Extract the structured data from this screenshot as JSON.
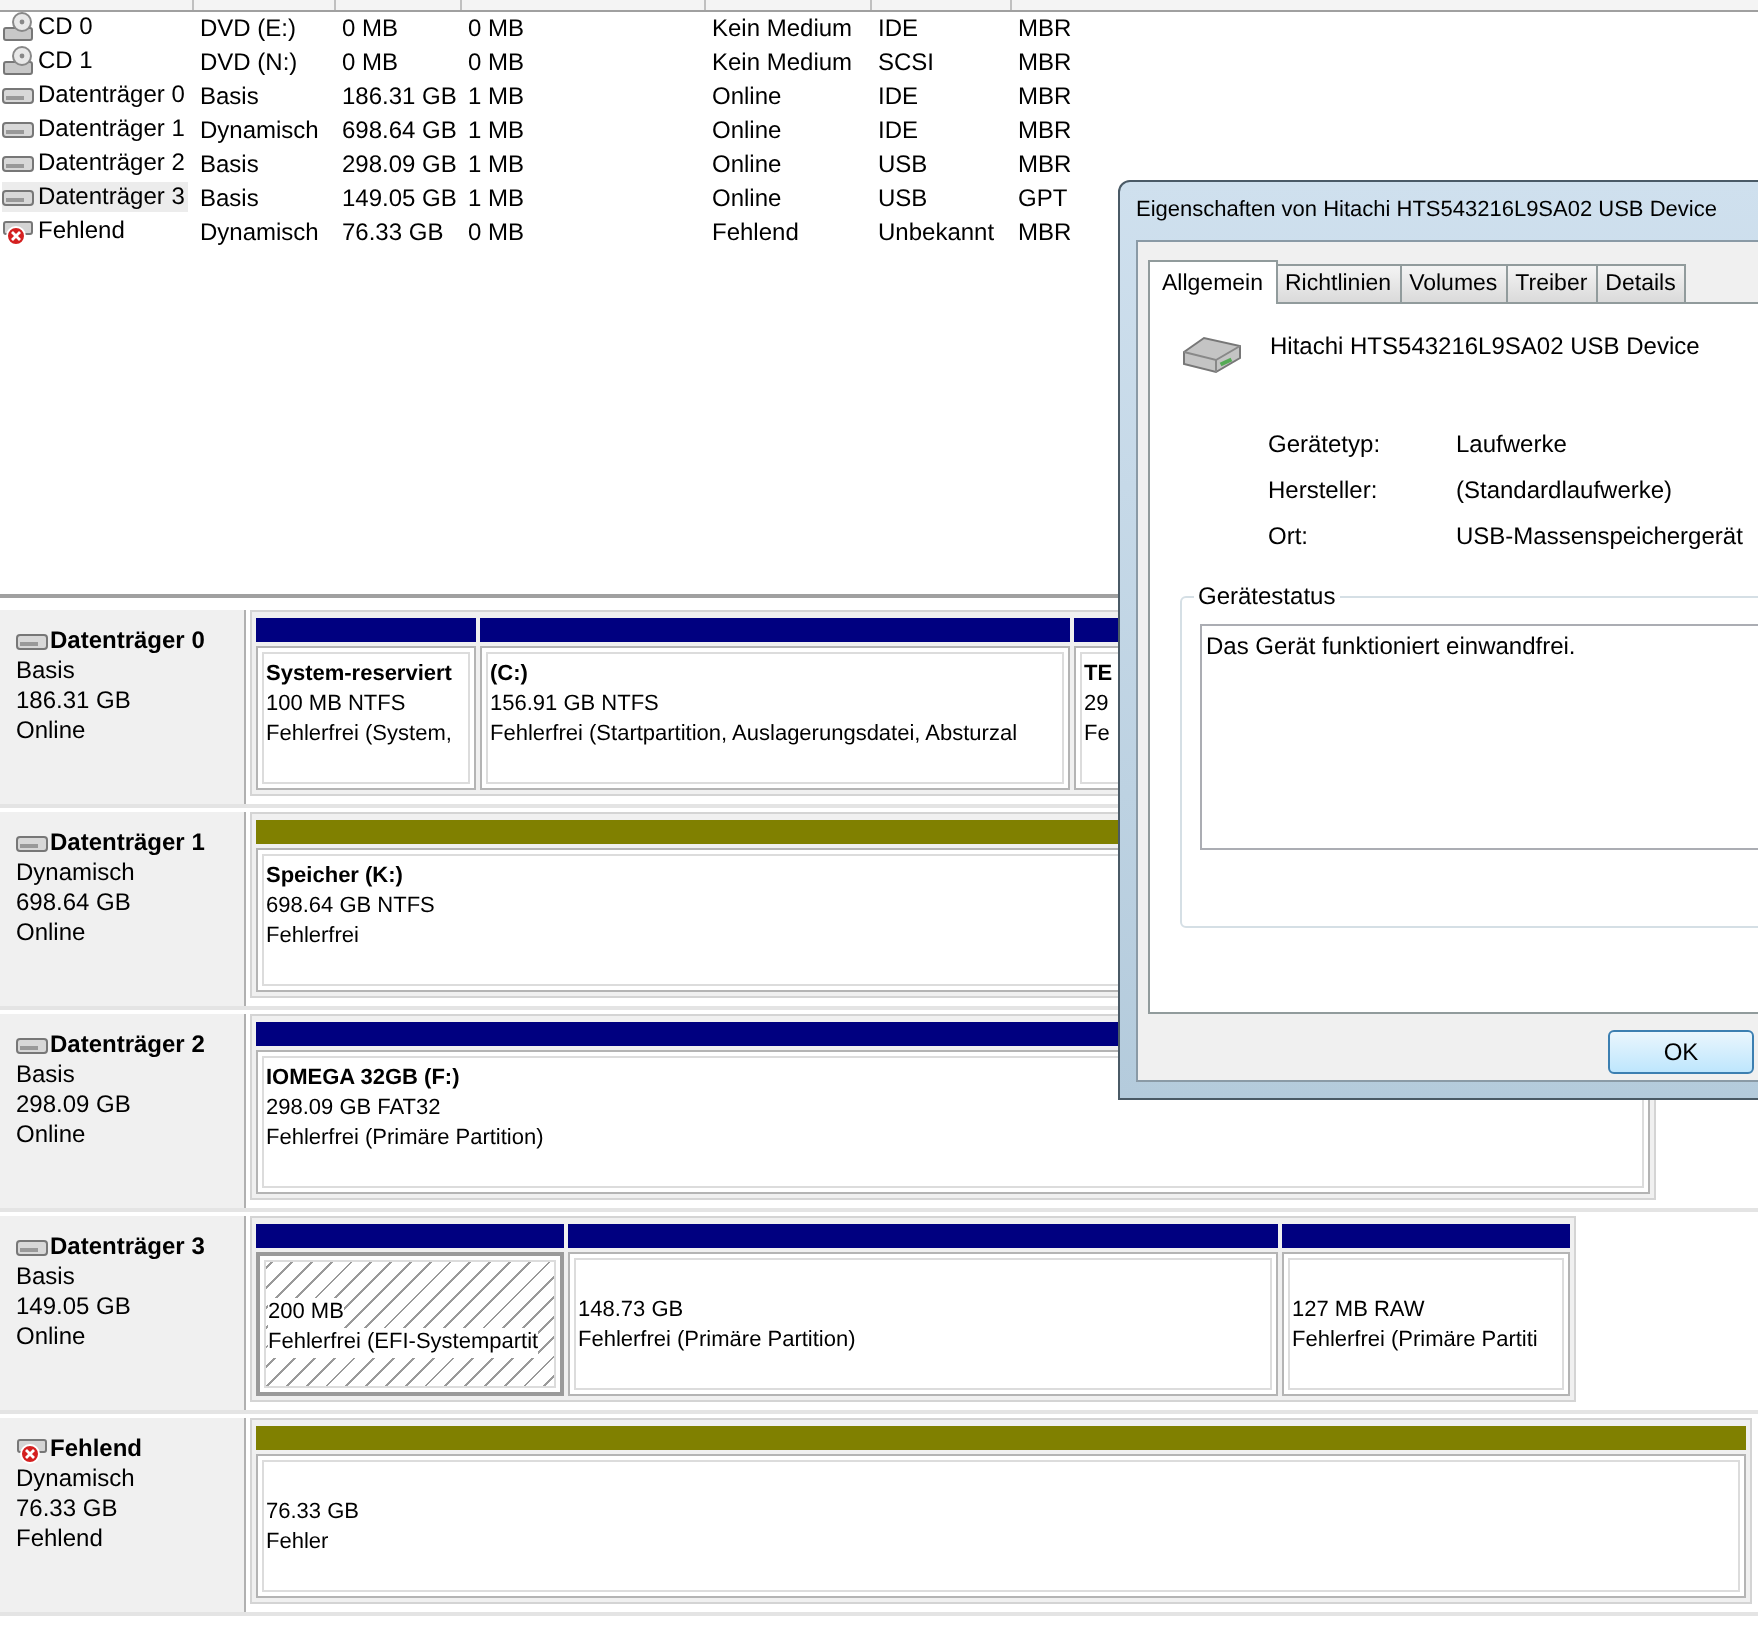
{
  "volume_list": {
    "rows": [
      {
        "kind": "cd",
        "selected": false,
        "cells": [
          "CD 0",
          "DVD (E:)",
          "0 MB",
          "0 MB",
          "Kein Medium",
          "IDE",
          "MBR"
        ]
      },
      {
        "kind": "cd",
        "selected": false,
        "cells": [
          "CD 1",
          "DVD (N:)",
          "0 MB",
          "0 MB",
          "Kein Medium",
          "SCSI",
          "MBR"
        ]
      },
      {
        "kind": "disk",
        "selected": false,
        "cells": [
          "Datenträger 0",
          "Basis",
          "186.31 GB",
          "1 MB",
          "Online",
          "IDE",
          "MBR"
        ]
      },
      {
        "kind": "disk",
        "selected": false,
        "cells": [
          "Datenträger 1",
          "Dynamisch",
          "698.64 GB",
          "1 MB",
          "Online",
          "IDE",
          "MBR"
        ]
      },
      {
        "kind": "disk",
        "selected": false,
        "cells": [
          "Datenträger 2",
          "Basis",
          "298.09 GB",
          "1 MB",
          "Online",
          "USB",
          "MBR"
        ]
      },
      {
        "kind": "disk",
        "selected": true,
        "cells": [
          "Datenträger 3",
          "Basis",
          "149.05 GB",
          "1 MB",
          "Online",
          "USB",
          "GPT"
        ]
      },
      {
        "kind": "missing",
        "selected": false,
        "cells": [
          "Fehlend",
          "Dynamisch",
          "76.33 GB",
          "0 MB",
          "Fehlend",
          "Unbekannt",
          "MBR"
        ]
      }
    ]
  },
  "disk_map": [
    {
      "kind": "disk",
      "name": "Datenträger 0",
      "type": "Basis",
      "size": "186.31 GB",
      "status": "Online",
      "partitions": [
        {
          "kind": "primary",
          "selected": false,
          "title": "System-reserviert",
          "detail": "100 MB NTFS",
          "status": "Fehlerfrei (System,"
        },
        {
          "kind": "primary",
          "selected": false,
          "title": "(C:)",
          "detail": "156.91 GB NTFS",
          "status": "Fehlerfrei (Startpartition, Auslagerungsdatei, Absturzal"
        },
        {
          "kind": "primary",
          "selected": false,
          "title": "TE",
          "detail": "29",
          "status": "Fe"
        }
      ]
    },
    {
      "kind": "disk",
      "name": "Datenträger 1",
      "type": "Dynamisch",
      "size": "698.64 GB",
      "status": "Online",
      "partitions": [
        {
          "kind": "simple",
          "selected": false,
          "title": "Speicher  (K:)",
          "detail": "698.64 GB NTFS",
          "status": "Fehlerfrei"
        }
      ]
    },
    {
      "kind": "disk",
      "name": "Datenträger 2",
      "type": "Basis",
      "size": "298.09 GB",
      "status": "Online",
      "partitions": [
        {
          "kind": "primary",
          "selected": false,
          "title": "IOMEGA 32GB  (F:)",
          "detail": "298.09 GB FAT32",
          "status": "Fehlerfrei (Primäre Partition)"
        }
      ]
    },
    {
      "kind": "disk",
      "name": "Datenträger 3",
      "type": "Basis",
      "size": "149.05 GB",
      "status": "Online",
      "partitions": [
        {
          "kind": "primary",
          "selected": true,
          "detail": "200 MB",
          "status": "Fehlerfrei (EFI-Systempartit"
        },
        {
          "kind": "primary",
          "selected": false,
          "detail": "148.73 GB",
          "status": "Fehlerfrei (Primäre Partition)"
        },
        {
          "kind": "primary",
          "selected": false,
          "detail": "127 MB RAW",
          "status": "Fehlerfrei (Primäre Partiti"
        }
      ]
    },
    {
      "kind": "missing",
      "name": "Fehlend",
      "type": "Dynamisch",
      "size": "76.33 GB",
      "status": "Fehlend",
      "partitions": [
        {
          "kind": "simple",
          "selected": false,
          "detail": "76.33 GB",
          "status": "Fehler"
        }
      ]
    }
  ],
  "dialog": {
    "title": "Eigenschaften von Hitachi HTS543216L9SA02 USB Device",
    "tabs": [
      {
        "label": "Allgemein",
        "selected": true
      },
      {
        "label": "Richtlinien",
        "selected": false
      },
      {
        "label": "Volumes",
        "selected": false
      },
      {
        "label": "Treiber",
        "selected": false
      },
      {
        "label": "Details",
        "selected": false
      }
    ],
    "device_name": "Hitachi HTS543216L9SA02 USB Device",
    "properties": [
      {
        "label": "Gerätetyp:",
        "value": "Laufwerke"
      },
      {
        "label": "Hersteller:",
        "value": "(Standardlaufwerke)"
      },
      {
        "label": "Ort:",
        "value": "USB-Massenspeichergerät"
      }
    ],
    "status_group": {
      "label": "Gerätestatus",
      "text": "Das Gerät funktioniert einwandfrei."
    },
    "buttons": [
      "OK"
    ]
  }
}
